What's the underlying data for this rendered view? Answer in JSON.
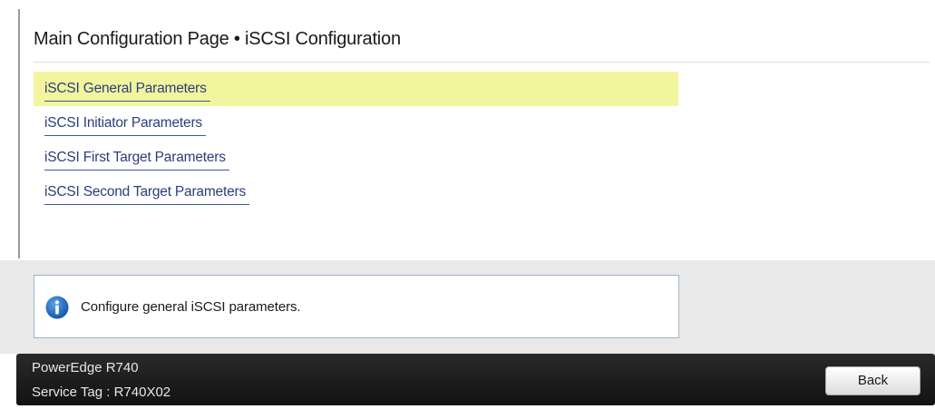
{
  "page": {
    "title": "Main Configuration Page • iSCSI Configuration"
  },
  "menu": {
    "items": [
      {
        "label": "iSCSI General Parameters",
        "selected": true
      },
      {
        "label": "iSCSI Initiator Parameters",
        "selected": false
      },
      {
        "label": "iSCSI First Target Parameters",
        "selected": false
      },
      {
        "label": "iSCSI Second Target Parameters",
        "selected": false
      }
    ]
  },
  "help": {
    "icon": "info-icon",
    "text": "Configure general iSCSI parameters."
  },
  "footer": {
    "model": "PowerEdge R740",
    "service_tag": "Service Tag : R740X02",
    "back_label": "Back"
  },
  "colors": {
    "selected_highlight": "#f2f59e",
    "link": "#2a3f7a",
    "footer_bg": "#1a1a1a",
    "help_area_bg": "#e9e9e9",
    "info_icon_blue": "#1e6fc4"
  }
}
